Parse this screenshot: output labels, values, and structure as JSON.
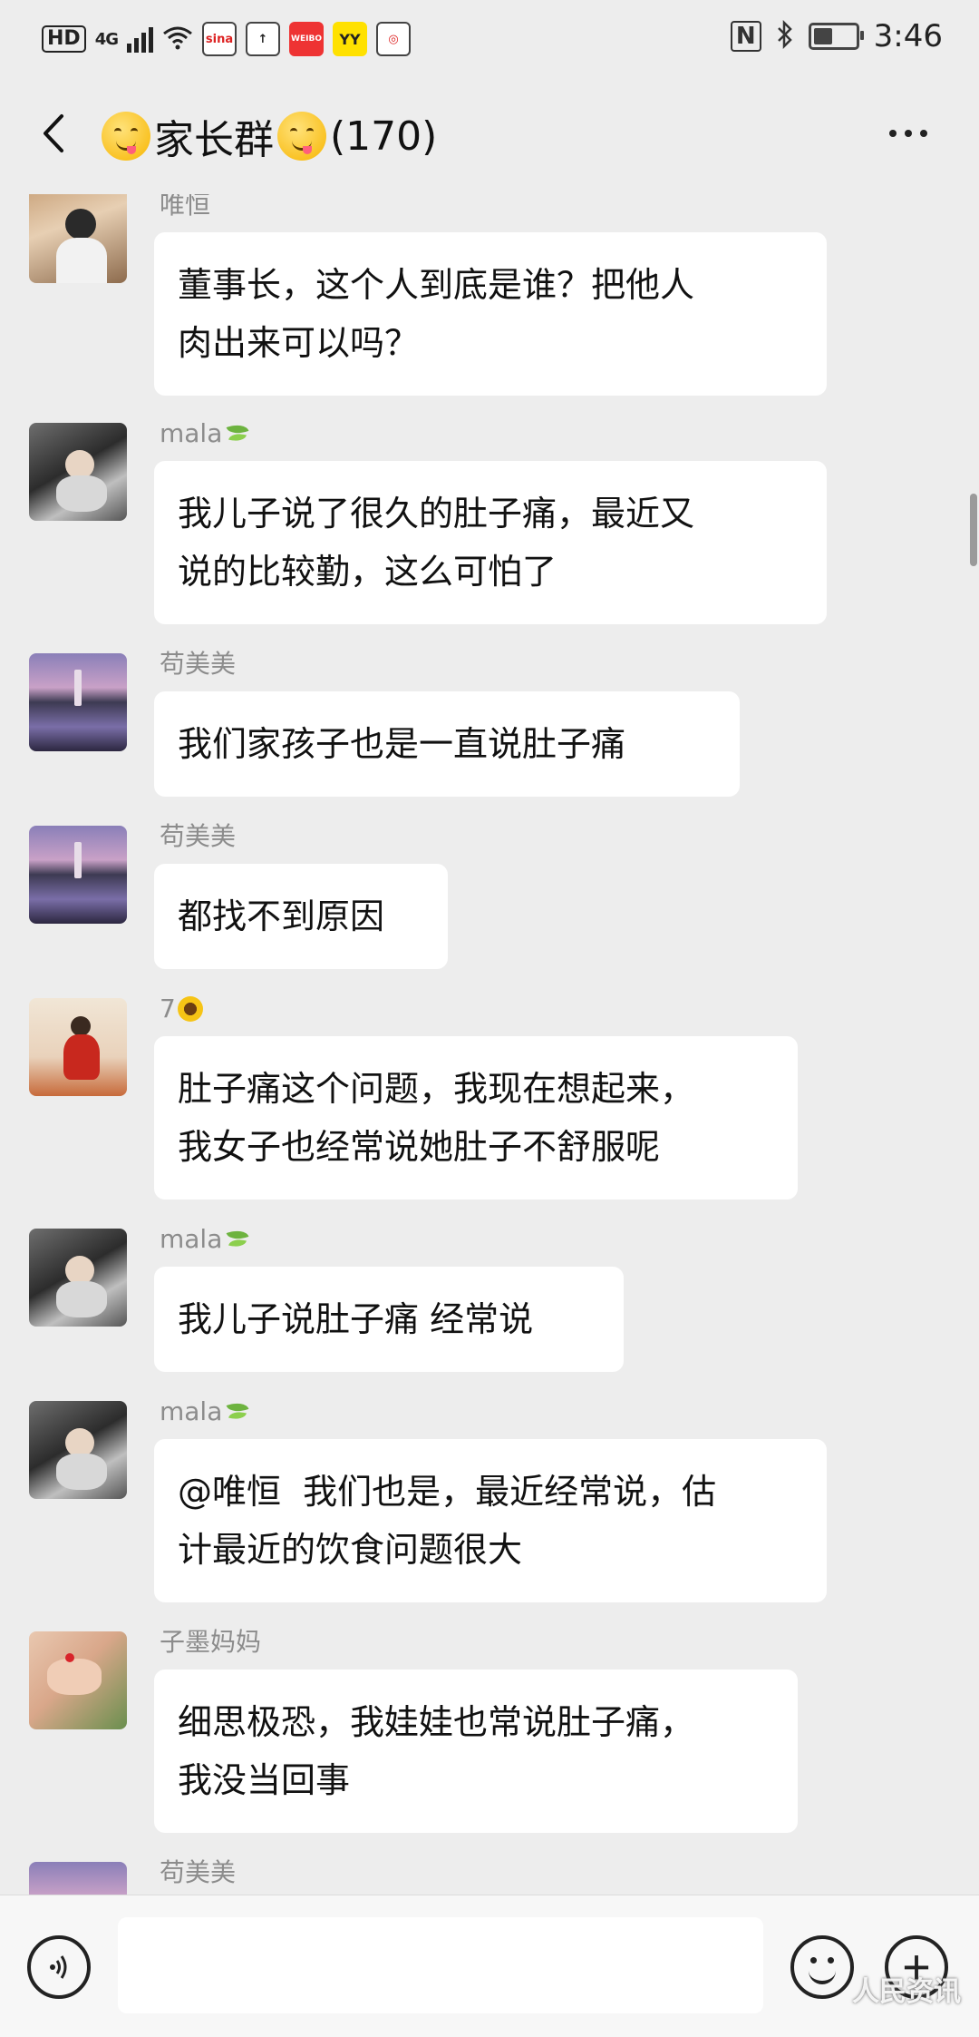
{
  "status_bar": {
    "hd": "HD",
    "network": "4G",
    "app_icons": [
      "sina-icon",
      "upload-icon",
      "weibo-icon",
      "yy-icon",
      "weibo-red-icon"
    ],
    "app_labels": [
      "sina",
      "↑",
      "WEIBO",
      "YY",
      "◎"
    ],
    "nfc": "N",
    "bluetooth": "∦",
    "battery_level": 0.45,
    "time": "3:46"
  },
  "header": {
    "back_icon": "chevron-left-icon",
    "title": "家长群",
    "member_count": "(170)",
    "more_icon": "more-dots-icon"
  },
  "messages": [
    {
      "sender": "唯恒",
      "badge": "",
      "avatar": "woman-sunglasses-photo",
      "text": "董事长，这个人到底是谁？把他人\n肉出来可以吗？"
    },
    {
      "sender": "mala",
      "badge": "leaf",
      "avatar": "child-in-car-photo",
      "text": "我儿子说了很久的肚子痛，最近又\n说的比较勤，这么可怕了"
    },
    {
      "sender": "苟美美",
      "badge": "",
      "avatar": "pagoda-lake-photo",
      "text": "我们家孩子也是一直说肚子痛"
    },
    {
      "sender": "苟美美",
      "badge": "",
      "avatar": "pagoda-lake-photo",
      "text": "都找不到原因"
    },
    {
      "sender": "7",
      "badge": "sunflower",
      "avatar": "girl-red-dress-photo",
      "text": "肚子痛这个问题，我现在想起来，\n我女子也经常说她肚子不舒服呢"
    },
    {
      "sender": "mala",
      "badge": "leaf",
      "avatar": "child-in-car-photo",
      "text": "我儿子说肚子痛 经常说"
    },
    {
      "sender": "mala",
      "badge": "leaf",
      "avatar": "child-in-car-photo",
      "text": "@唯恒  我们也是，最近经常说，估\n计最近的饮食问题很大"
    },
    {
      "sender": "子墨妈妈",
      "badge": "",
      "avatar": "hands-photo",
      "text": "细思极恐，我娃娃也常说肚子痛，\n我没当回事"
    },
    {
      "sender": "苟美美",
      "badge": "",
      "avatar": "pagoda-lake-photo",
      "text": ""
    }
  ],
  "input_bar": {
    "voice_icon": "voice-icon",
    "input_value": "",
    "emoji_icon": "emoji-icon",
    "plus_icon": "plus-icon"
  },
  "watermark": "人民资讯"
}
